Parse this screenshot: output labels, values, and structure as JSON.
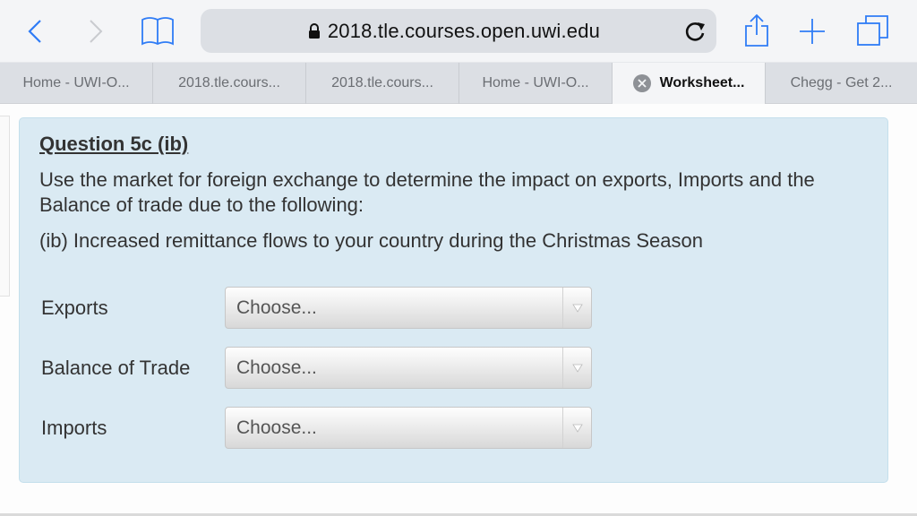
{
  "browser": {
    "url": "2018.tle.courses.open.uwi.edu",
    "icons": {
      "back": "chevron-left-icon",
      "forward": "chevron-right-icon",
      "bookmarks": "book-icon",
      "lock": "lock-icon",
      "reload": "reload-icon",
      "share": "share-icon",
      "new_tab": "plus-icon",
      "tabs": "tabs-icon"
    },
    "accent_color": "#2f7cf6"
  },
  "tabs": [
    {
      "label": "Home - UWI-O...",
      "active": false
    },
    {
      "label": "2018.tle.cours...",
      "active": false
    },
    {
      "label": "2018.tle.cours...",
      "active": false
    },
    {
      "label": "Home - UWI-O...",
      "active": false
    },
    {
      "label": "Worksheet...",
      "active": true
    },
    {
      "label": "Chegg - Get 2...",
      "active": false
    }
  ],
  "question": {
    "title": "Question 5c (ib)",
    "body": "Use the market for foreign exchange to determine the impact on exports, Imports and the Balance of trade due to the following:",
    "sub": "(ib) Increased remittance flows to your country during the Christmas Season",
    "fields": [
      {
        "label": "Exports",
        "value": "Choose..."
      },
      {
        "label": "Balance of Trade",
        "value": "Choose..."
      },
      {
        "label": "Imports",
        "value": "Choose..."
      }
    ]
  }
}
